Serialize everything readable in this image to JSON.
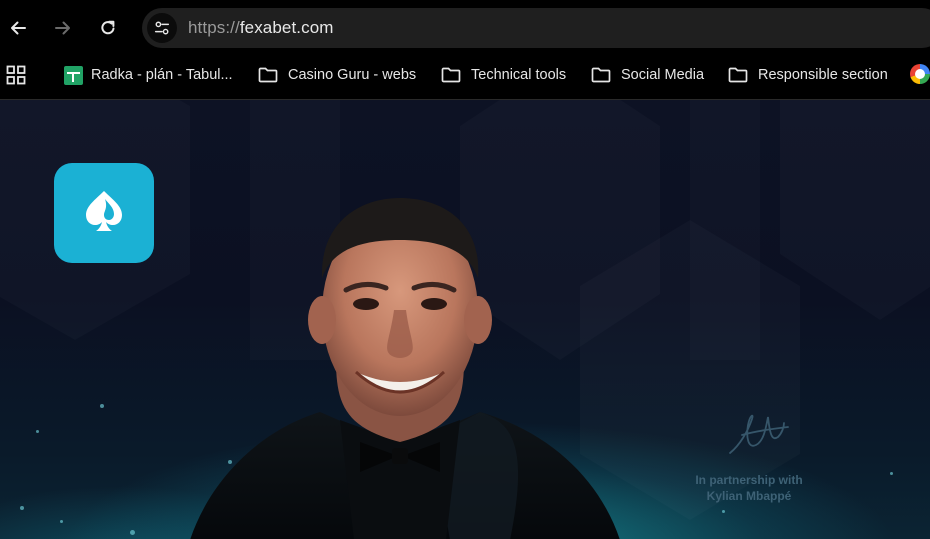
{
  "browser": {
    "url_scheme": "https://",
    "url_host": "fexabet.com",
    "icons": {
      "back": "arrow-left-icon",
      "forward": "arrow-right-icon",
      "reload": "reload-icon",
      "site_info": "tune-icon"
    }
  },
  "bookmarks": [
    {
      "label": "Radka - plán - Tabul...",
      "icon": "sheets-icon"
    },
    {
      "label": "Casino Guru - webs",
      "icon": "folder-icon"
    },
    {
      "label": "Technical tools",
      "icon": "folder-icon"
    },
    {
      "label": "Social Media",
      "icon": "folder-icon"
    },
    {
      "label": "Responsible section",
      "icon": "folder-icon"
    }
  ],
  "page": {
    "brand_color": "#1bb1d4",
    "partnership_line1": "In partnership with",
    "partnership_line2": "Kylian Mbappé"
  }
}
